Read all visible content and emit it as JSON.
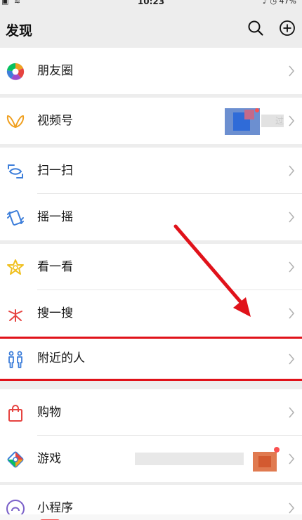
{
  "status_bar": {
    "time": "10:23",
    "battery": "47%"
  },
  "header": {
    "title": "发现"
  },
  "groups": [
    {
      "items": [
        {
          "label": "朋友圈"
        }
      ]
    },
    {
      "items": [
        {
          "label": "视频号",
          "extra_text": "过"
        }
      ]
    },
    {
      "items": [
        {
          "label": "扫一扫"
        },
        {
          "label": "摇一摇"
        }
      ]
    },
    {
      "items": [
        {
          "label": "看一看"
        },
        {
          "label": "搜一搜"
        }
      ]
    },
    {
      "items": [
        {
          "label": "附近的人",
          "highlighted": true
        }
      ]
    },
    {
      "items": [
        {
          "label": "购物"
        },
        {
          "label": "游戏"
        }
      ]
    },
    {
      "items": [
        {
          "label": "小程序"
        }
      ]
    }
  ],
  "colors": {
    "accent_green": "#07c160",
    "highlight_red": "#e0121a",
    "icon_blue": "#3d7eda",
    "icon_orange": "#f0a020",
    "icon_red": "#e64340"
  },
  "icons": {
    "moments": "moments-aperture-icon",
    "channels": "channels-butterfly-icon",
    "scan": "scan-icon",
    "shake": "shake-icon",
    "top_stories": "top-stories-icon",
    "search": "search-sparkle-icon",
    "nearby": "people-nearby-icon",
    "shopping": "shopping-bag-icon",
    "games": "games-icon",
    "mini_programs": "mini-programs-icon"
  }
}
